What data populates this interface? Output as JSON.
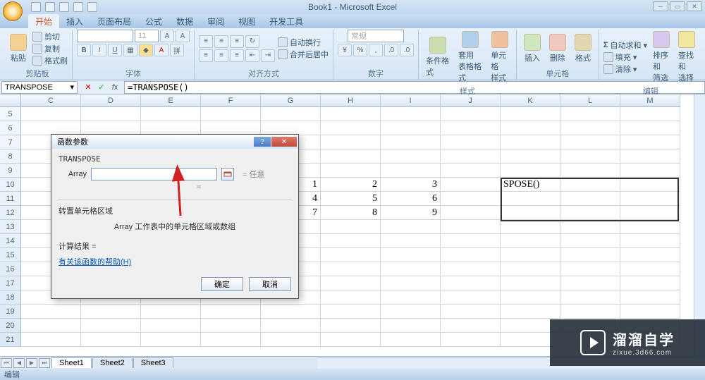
{
  "window": {
    "title": "Book1 - Microsoft Excel"
  },
  "tabs": [
    "开始",
    "插入",
    "页面布局",
    "公式",
    "数据",
    "审阅",
    "视图",
    "开发工具"
  ],
  "active_tab": "开始",
  "ribbon": {
    "clipboard": {
      "label": "剪贴板",
      "paste": "粘贴",
      "cut": "剪切",
      "copy": "复制",
      "format_painter": "格式刷"
    },
    "font": {
      "label": "字体",
      "name": "",
      "size": "11",
      "bold": "B",
      "italic": "I",
      "underline": "U"
    },
    "alignment": {
      "label": "对齐方式",
      "wrap": "自动换行",
      "merge": "合并后居中"
    },
    "number": {
      "label": "数字",
      "format": "常规"
    },
    "styles": {
      "label": "样式",
      "cond": "条件格式",
      "table": "套用\n表格格式",
      "cell": "单元格\n样式"
    },
    "cells": {
      "label": "单元格",
      "insert": "插入",
      "delete": "删除",
      "format": "格式"
    },
    "editing": {
      "label": "编辑",
      "autosum": "自动求和",
      "fill": "填充",
      "clear": "清除",
      "sort": "排序和\n筛选",
      "find": "查找和\n选择"
    }
  },
  "name_box": "TRANSPOSE",
  "formula": "=TRANSPOSE()",
  "columns": [
    {
      "id": "C",
      "w": 85
    },
    {
      "id": "D",
      "w": 85
    },
    {
      "id": "E",
      "w": 85
    },
    {
      "id": "F",
      "w": 85
    },
    {
      "id": "G",
      "w": 85
    },
    {
      "id": "H",
      "w": 85
    },
    {
      "id": "I",
      "w": 85
    },
    {
      "id": "J",
      "w": 85
    },
    {
      "id": "K",
      "w": 85
    },
    {
      "id": "L",
      "w": 85
    },
    {
      "id": "M",
      "w": 85
    }
  ],
  "rows": [
    "5",
    "6",
    "7",
    "8",
    "9",
    "10",
    "11",
    "12",
    "13",
    "14",
    "15",
    "16",
    "17",
    "18",
    "19",
    "20",
    "21"
  ],
  "cell_values": {
    "G10": "1",
    "H10": "2",
    "I10": "3",
    "G11": "4",
    "H11": "5",
    "I11": "6",
    "G12": "7",
    "H12": "8",
    "I12": "9"
  },
  "active_cell_display": "SPOSE()",
  "dialog": {
    "title": "函数参数",
    "fn": "TRANSPOSE",
    "arg_label": "Array",
    "arg_hint": "任意",
    "desc1": "转置单元格区域",
    "desc2": "Array  工作表中的单元格区域或数组",
    "result_label": "计算结果 =",
    "help": "有关该函数的帮助(H)",
    "ok": "确定",
    "cancel": "取消"
  },
  "sheets": [
    "Sheet1",
    "Sheet2",
    "Sheet3"
  ],
  "status": "编辑",
  "watermark": {
    "main": "溜溜自学",
    "sub": "zixue.3d66.com"
  }
}
